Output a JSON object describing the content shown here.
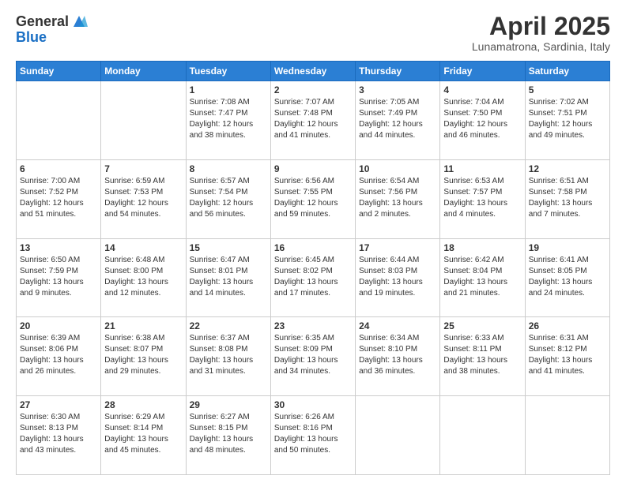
{
  "header": {
    "logo_general": "General",
    "logo_blue": "Blue",
    "title": "April 2025",
    "subtitle": "Lunamatrona, Sardinia, Italy"
  },
  "days_of_week": [
    "Sunday",
    "Monday",
    "Tuesday",
    "Wednesday",
    "Thursday",
    "Friday",
    "Saturday"
  ],
  "weeks": [
    [
      {
        "day": "",
        "sunrise": "",
        "sunset": "",
        "daylight": ""
      },
      {
        "day": "",
        "sunrise": "",
        "sunset": "",
        "daylight": ""
      },
      {
        "day": "1",
        "sunrise": "Sunrise: 7:08 AM",
        "sunset": "Sunset: 7:47 PM",
        "daylight": "Daylight: 12 hours and 38 minutes."
      },
      {
        "day": "2",
        "sunrise": "Sunrise: 7:07 AM",
        "sunset": "Sunset: 7:48 PM",
        "daylight": "Daylight: 12 hours and 41 minutes."
      },
      {
        "day": "3",
        "sunrise": "Sunrise: 7:05 AM",
        "sunset": "Sunset: 7:49 PM",
        "daylight": "Daylight: 12 hours and 44 minutes."
      },
      {
        "day": "4",
        "sunrise": "Sunrise: 7:04 AM",
        "sunset": "Sunset: 7:50 PM",
        "daylight": "Daylight: 12 hours and 46 minutes."
      },
      {
        "day": "5",
        "sunrise": "Sunrise: 7:02 AM",
        "sunset": "Sunset: 7:51 PM",
        "daylight": "Daylight: 12 hours and 49 minutes."
      }
    ],
    [
      {
        "day": "6",
        "sunrise": "Sunrise: 7:00 AM",
        "sunset": "Sunset: 7:52 PM",
        "daylight": "Daylight: 12 hours and 51 minutes."
      },
      {
        "day": "7",
        "sunrise": "Sunrise: 6:59 AM",
        "sunset": "Sunset: 7:53 PM",
        "daylight": "Daylight: 12 hours and 54 minutes."
      },
      {
        "day": "8",
        "sunrise": "Sunrise: 6:57 AM",
        "sunset": "Sunset: 7:54 PM",
        "daylight": "Daylight: 12 hours and 56 minutes."
      },
      {
        "day": "9",
        "sunrise": "Sunrise: 6:56 AM",
        "sunset": "Sunset: 7:55 PM",
        "daylight": "Daylight: 12 hours and 59 minutes."
      },
      {
        "day": "10",
        "sunrise": "Sunrise: 6:54 AM",
        "sunset": "Sunset: 7:56 PM",
        "daylight": "Daylight: 13 hours and 2 minutes."
      },
      {
        "day": "11",
        "sunrise": "Sunrise: 6:53 AM",
        "sunset": "Sunset: 7:57 PM",
        "daylight": "Daylight: 13 hours and 4 minutes."
      },
      {
        "day": "12",
        "sunrise": "Sunrise: 6:51 AM",
        "sunset": "Sunset: 7:58 PM",
        "daylight": "Daylight: 13 hours and 7 minutes."
      }
    ],
    [
      {
        "day": "13",
        "sunrise": "Sunrise: 6:50 AM",
        "sunset": "Sunset: 7:59 PM",
        "daylight": "Daylight: 13 hours and 9 minutes."
      },
      {
        "day": "14",
        "sunrise": "Sunrise: 6:48 AM",
        "sunset": "Sunset: 8:00 PM",
        "daylight": "Daylight: 13 hours and 12 minutes."
      },
      {
        "day": "15",
        "sunrise": "Sunrise: 6:47 AM",
        "sunset": "Sunset: 8:01 PM",
        "daylight": "Daylight: 13 hours and 14 minutes."
      },
      {
        "day": "16",
        "sunrise": "Sunrise: 6:45 AM",
        "sunset": "Sunset: 8:02 PM",
        "daylight": "Daylight: 13 hours and 17 minutes."
      },
      {
        "day": "17",
        "sunrise": "Sunrise: 6:44 AM",
        "sunset": "Sunset: 8:03 PM",
        "daylight": "Daylight: 13 hours and 19 minutes."
      },
      {
        "day": "18",
        "sunrise": "Sunrise: 6:42 AM",
        "sunset": "Sunset: 8:04 PM",
        "daylight": "Daylight: 13 hours and 21 minutes."
      },
      {
        "day": "19",
        "sunrise": "Sunrise: 6:41 AM",
        "sunset": "Sunset: 8:05 PM",
        "daylight": "Daylight: 13 hours and 24 minutes."
      }
    ],
    [
      {
        "day": "20",
        "sunrise": "Sunrise: 6:39 AM",
        "sunset": "Sunset: 8:06 PM",
        "daylight": "Daylight: 13 hours and 26 minutes."
      },
      {
        "day": "21",
        "sunrise": "Sunrise: 6:38 AM",
        "sunset": "Sunset: 8:07 PM",
        "daylight": "Daylight: 13 hours and 29 minutes."
      },
      {
        "day": "22",
        "sunrise": "Sunrise: 6:37 AM",
        "sunset": "Sunset: 8:08 PM",
        "daylight": "Daylight: 13 hours and 31 minutes."
      },
      {
        "day": "23",
        "sunrise": "Sunrise: 6:35 AM",
        "sunset": "Sunset: 8:09 PM",
        "daylight": "Daylight: 13 hours and 34 minutes."
      },
      {
        "day": "24",
        "sunrise": "Sunrise: 6:34 AM",
        "sunset": "Sunset: 8:10 PM",
        "daylight": "Daylight: 13 hours and 36 minutes."
      },
      {
        "day": "25",
        "sunrise": "Sunrise: 6:33 AM",
        "sunset": "Sunset: 8:11 PM",
        "daylight": "Daylight: 13 hours and 38 minutes."
      },
      {
        "day": "26",
        "sunrise": "Sunrise: 6:31 AM",
        "sunset": "Sunset: 8:12 PM",
        "daylight": "Daylight: 13 hours and 41 minutes."
      }
    ],
    [
      {
        "day": "27",
        "sunrise": "Sunrise: 6:30 AM",
        "sunset": "Sunset: 8:13 PM",
        "daylight": "Daylight: 13 hours and 43 minutes."
      },
      {
        "day": "28",
        "sunrise": "Sunrise: 6:29 AM",
        "sunset": "Sunset: 8:14 PM",
        "daylight": "Daylight: 13 hours and 45 minutes."
      },
      {
        "day": "29",
        "sunrise": "Sunrise: 6:27 AM",
        "sunset": "Sunset: 8:15 PM",
        "daylight": "Daylight: 13 hours and 48 minutes."
      },
      {
        "day": "30",
        "sunrise": "Sunrise: 6:26 AM",
        "sunset": "Sunset: 8:16 PM",
        "daylight": "Daylight: 13 hours and 50 minutes."
      },
      {
        "day": "",
        "sunrise": "",
        "sunset": "",
        "daylight": ""
      },
      {
        "day": "",
        "sunrise": "",
        "sunset": "",
        "daylight": ""
      },
      {
        "day": "",
        "sunrise": "",
        "sunset": "",
        "daylight": ""
      }
    ]
  ]
}
